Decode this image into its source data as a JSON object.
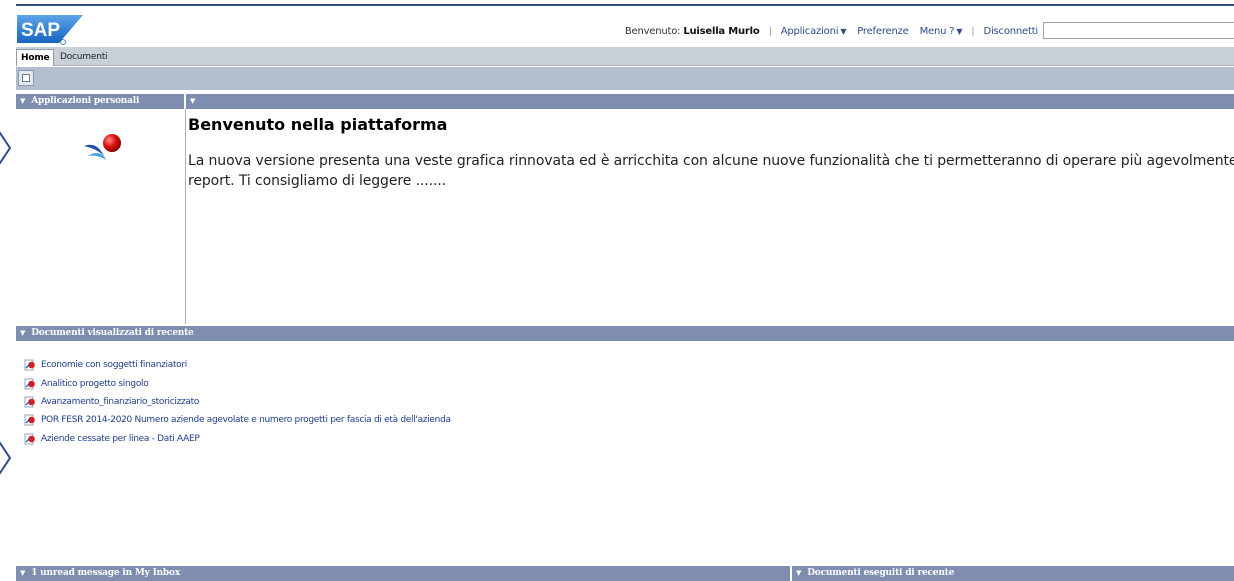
{
  "header": {
    "logo_text": "SAP",
    "welcome_label": "Benvenuto:",
    "user_name": "Luisella Murlo",
    "links": {
      "applications": "Applicazioni",
      "preferences": "Preferenze",
      "help_menu": "Menu ?",
      "logout": "Disconnetti"
    },
    "search_value": ""
  },
  "tabs": [
    {
      "label": "Home",
      "active": true
    },
    {
      "label": "Documenti",
      "active": false
    }
  ],
  "sections": {
    "personal_apps": "Applicazioni personali",
    "main_panel": "",
    "recent_docs": "Documenti visualizzati di recente",
    "inbox": "1 unread message in My Inbox",
    "executed_docs": "Documenti eseguiti di recente"
  },
  "welcome": {
    "title": "Benvenuto nella piattaforma",
    "line1": "La nuova versione presenta una veste grafica rinnovata ed è arricchita con alcune nuove funzionalità che ti permetteranno di operare più agevolmente",
    "line2": "report. Ti consigliamo di leggere ......."
  },
  "recent_documents": [
    "Economie con soggetti finanziatori",
    "Analitico progetto singolo",
    "Avanzamento_finanziario_storicizzato",
    "POR FESR 2014-2020 Numero aziende agevolate e numero progetti per fascia di età dell'azienda",
    "Aziende cessate per linea - Dati AAEP"
  ],
  "colors": {
    "accent": "#2c4e8c",
    "section_header": "#7e8db0",
    "tab_strip": "#c9cfd7",
    "tool_strip": "#b3bfcf"
  }
}
